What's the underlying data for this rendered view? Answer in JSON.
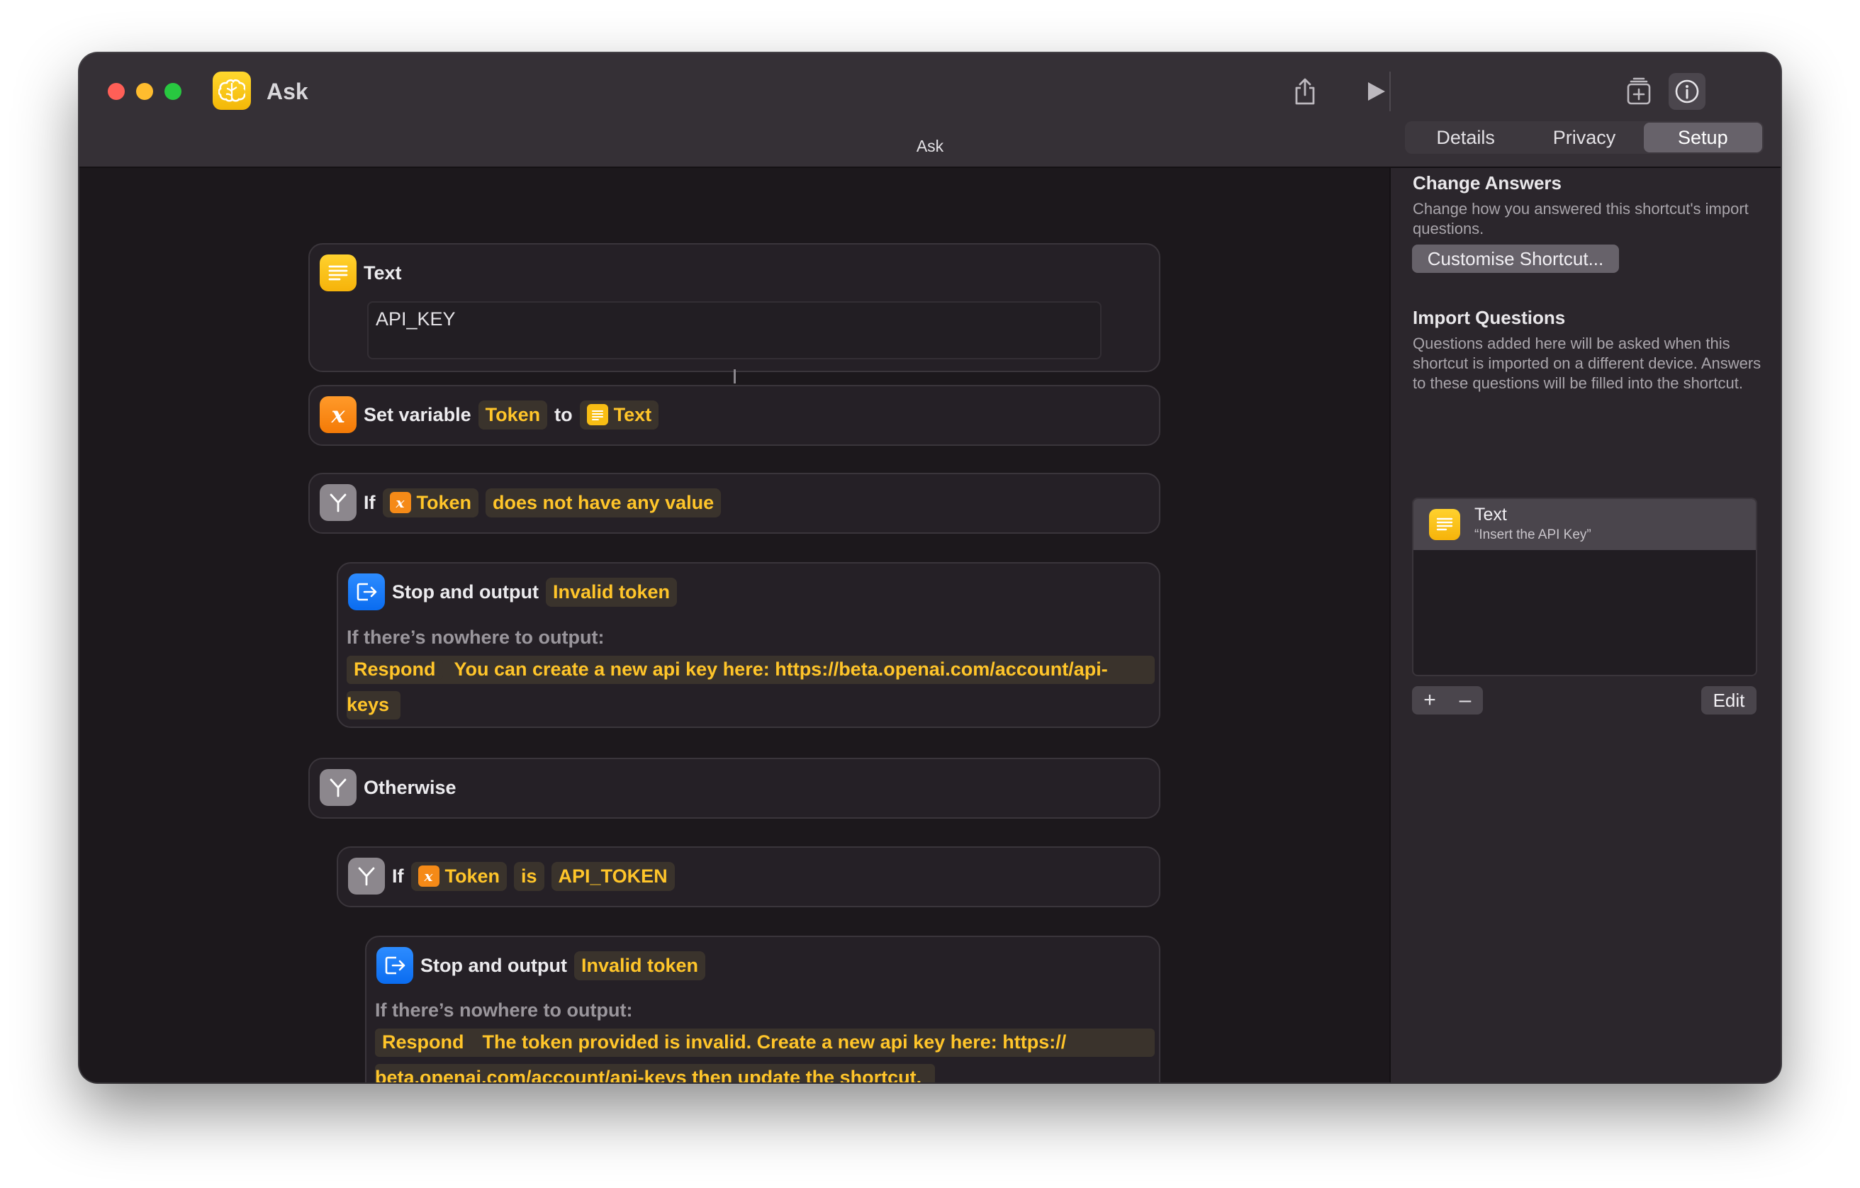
{
  "window": {
    "title": "Ask",
    "subtitle": "Ask"
  },
  "icons": {
    "share": "share-icon",
    "run": "play-icon",
    "library": "add-to-library-icon",
    "info": "info-icon"
  },
  "colors": {
    "accent_token": "#ffc52a",
    "token_bg": "#3a332c",
    "window_bg": "#1c181c",
    "sidebar_bg": "#2b262c"
  },
  "actions": {
    "text": {
      "title": "Text",
      "value": "API_KEY"
    },
    "set_variable": {
      "label": "Set variable",
      "variable": "Token",
      "to": "to",
      "source": "Text"
    },
    "if1": {
      "label": "If",
      "variable": "Token",
      "condition": "does not have any value"
    },
    "stop1": {
      "label": "Stop and output",
      "output": "Invalid token",
      "fallback_label": "If there’s nowhere to output:",
      "respond": "Respond",
      "message_line1": "You can create a new api key here: https://beta.openai.com/account/api-",
      "message_line2": "keys"
    },
    "otherwise": {
      "label": "Otherwise"
    },
    "if2": {
      "label": "If",
      "variable": "Token",
      "operator": "is",
      "value": "API_TOKEN"
    },
    "stop2": {
      "label": "Stop and output",
      "output": "Invalid token",
      "fallback_label": "If there’s nowhere to output:",
      "respond": "Respond",
      "message_line1": "The token provided is invalid.  Create a new api key here: https://",
      "message_line2": "beta.openai.com/account/api-keys then update the shortcut."
    }
  },
  "sidebar": {
    "tabs": [
      {
        "label": "Details",
        "active": false
      },
      {
        "label": "Privacy",
        "active": false
      },
      {
        "label": "Setup",
        "active": true
      }
    ],
    "change_answers": {
      "heading": "Change Answers",
      "description": "Change how you answered this shortcut's import questions.",
      "button": "Customise Shortcut..."
    },
    "import_questions": {
      "heading": "Import Questions",
      "description": "Questions added here will be asked when this shortcut is imported on a different device. Answers to these questions will be filled into the shortcut.",
      "items": [
        {
          "title": "Text",
          "subtitle": "“Insert the API Key”"
        }
      ],
      "add": "+",
      "remove": "–",
      "edit": "Edit"
    }
  }
}
